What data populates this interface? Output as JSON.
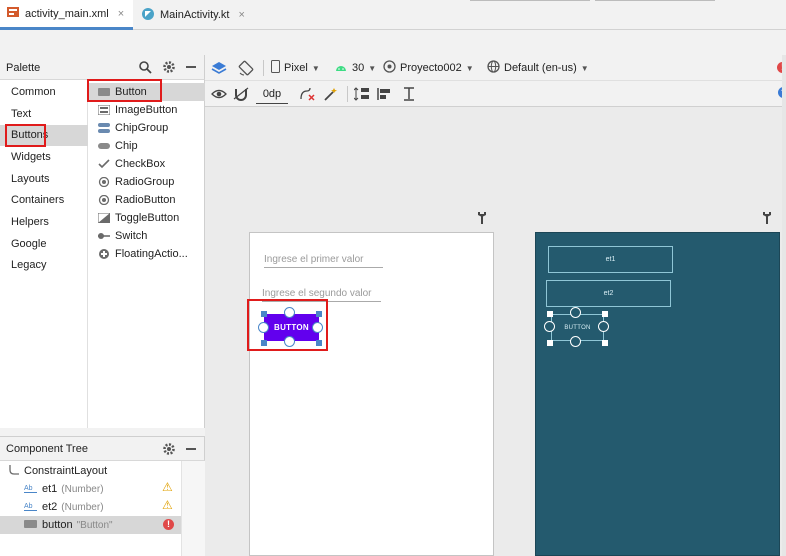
{
  "tabs": [
    {
      "label": "activity_main.xml",
      "icon": "xml-layout-icon",
      "close": "×"
    },
    {
      "label": "MainActivity.kt",
      "icon": "kotlin-file-icon",
      "close": "×"
    }
  ],
  "palette": {
    "title": "Palette",
    "categories": [
      "Common",
      "Text",
      "Buttons",
      "Widgets",
      "Layouts",
      "Containers",
      "Helpers",
      "Google",
      "Legacy"
    ],
    "selected_category": "Buttons",
    "items": [
      {
        "label": "Button",
        "icon": "button-icon"
      },
      {
        "label": "ImageButton",
        "icon": "image-button-icon"
      },
      {
        "label": "ChipGroup",
        "icon": "chip-group-icon"
      },
      {
        "label": "Chip",
        "icon": "chip-icon"
      },
      {
        "label": "CheckBox",
        "icon": "checkbox-icon"
      },
      {
        "label": "RadioGroup",
        "icon": "radio-group-icon"
      },
      {
        "label": "RadioButton",
        "icon": "radio-button-icon"
      },
      {
        "label": "ToggleButton",
        "icon": "toggle-button-icon"
      },
      {
        "label": "Switch",
        "icon": "switch-icon"
      },
      {
        "label": "FloatingActio...",
        "icon": "fab-icon"
      }
    ]
  },
  "toolbar": {
    "device": "Pixel",
    "api": "30",
    "theme": "Proyecto002",
    "locale": "Default (en-us)",
    "margin": "0dp"
  },
  "design": {
    "hint1": "Ingrese el primer valor",
    "hint2": "Ingrese el segundo valor",
    "button_text": "BUTTON"
  },
  "blueprint": {
    "et1": "et1",
    "et2": "et2",
    "button": "BUTTON"
  },
  "component_tree": {
    "title": "Component Tree",
    "root": "ConstraintLayout",
    "children": [
      {
        "id": "et1",
        "hint": "(Number)",
        "status": "warning"
      },
      {
        "id": "et2",
        "hint": "(Number)",
        "status": "warning"
      },
      {
        "id": "button",
        "hint": "\"Button\"",
        "status": "error"
      }
    ]
  },
  "colors": {
    "button_purple": "#6200ee",
    "blueprint_bg": "#245a6e",
    "highlight_red": "#e01b1b",
    "selection_blue": "#4a86c8"
  }
}
